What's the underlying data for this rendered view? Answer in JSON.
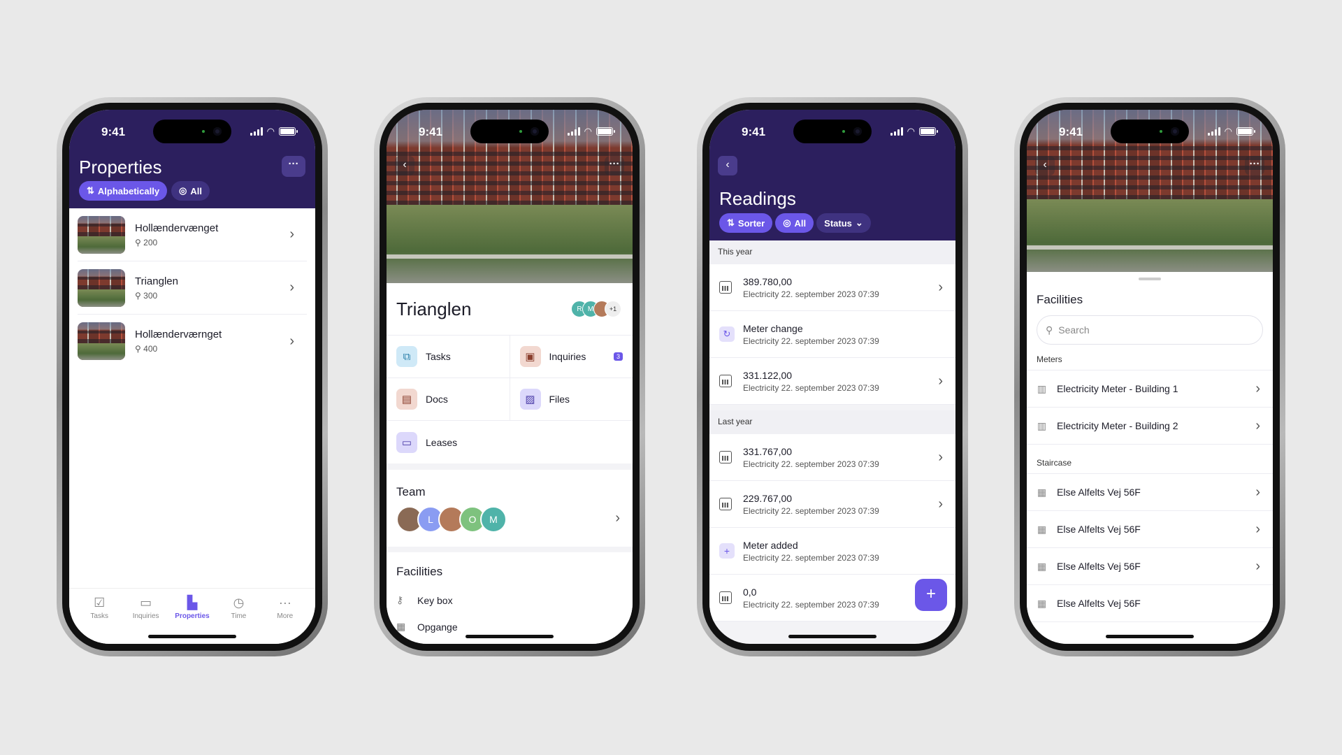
{
  "status_time": "9:41",
  "phone1": {
    "title": "Properties",
    "more_label": "···",
    "filters": [
      {
        "label": "Alphabetically",
        "icon": "sort-icon"
      },
      {
        "label": "All",
        "icon": "person-circle-icon"
      }
    ],
    "properties": [
      {
        "name": "Hollændervænget",
        "count": "200"
      },
      {
        "name": "Trianglen",
        "count": "300"
      },
      {
        "name": "Hollænderværnget",
        "count": "400"
      }
    ],
    "tabs": [
      {
        "label": "Tasks",
        "icon": "tasks-icon"
      },
      {
        "label": "Inquiries",
        "icon": "inbox-icon"
      },
      {
        "label": "Properties",
        "icon": "building-icon"
      },
      {
        "label": "Time",
        "icon": "stopwatch-icon"
      },
      {
        "label": "More",
        "icon": "more-icon"
      }
    ]
  },
  "phone2": {
    "title": "Trianglen",
    "avatars_extra": "+1",
    "avatar_letters": [
      "R",
      "M"
    ],
    "grid": [
      {
        "label": "Tasks",
        "icon": "tasks-icon",
        "color": "#cfe9f7"
      },
      {
        "label": "Inquiries",
        "icon": "briefcase-icon",
        "color": "#f2d8d0",
        "badge": "3"
      },
      {
        "label": "Docs",
        "icon": "document-icon",
        "color": "#f2d8d0"
      },
      {
        "label": "Files",
        "icon": "image-icon",
        "color": "#dcd8fb"
      },
      {
        "label": "Leases",
        "icon": "laptop-icon",
        "color": "#dcd8fb"
      }
    ],
    "team_title": "Team",
    "team": [
      {
        "letter": "",
        "color": "#8a6a55"
      },
      {
        "letter": "L",
        "color": "#8a9cf2"
      },
      {
        "letter": "",
        "color": "#b47a5a"
      },
      {
        "letter": "O",
        "color": "#7ec27e"
      },
      {
        "letter": "M",
        "color": "#4fb3a9"
      }
    ],
    "facilities_title": "Facilities",
    "facilities": [
      {
        "label": "Key box",
        "icon": "key-icon"
      },
      {
        "label": "Opgange",
        "icon": "building-icon"
      }
    ]
  },
  "phone3": {
    "title": "Readings",
    "filters": [
      {
        "label": "Sorter",
        "icon": "sort-icon"
      },
      {
        "label": "All",
        "icon": "person-circle-icon"
      },
      {
        "label": "Status",
        "icon": "chevron-down-icon"
      }
    ],
    "sections": [
      {
        "title": "This year",
        "rows": [
          {
            "title": "389.780,00",
            "sub": "Electricity 22. september 2023 07:39",
            "icon": "chart-icon",
            "chevron": true
          },
          {
            "title": "Meter change",
            "sub": "Electricity 22. september 2023 07:39",
            "icon": "refresh-icon",
            "chevron": false
          },
          {
            "title": "331.122,00",
            "sub": "Electricity 22. september 2023 07:39",
            "icon": "chart-icon",
            "chevron": true
          }
        ]
      },
      {
        "title": "Last year",
        "rows": [
          {
            "title": "331.767,00",
            "sub": "Electricity 22. september 2023 07:39",
            "icon": "chart-icon",
            "chevron": true
          },
          {
            "title": "229.767,00",
            "sub": "Electricity 22. september 2023 07:39",
            "icon": "chart-icon",
            "chevron": true
          },
          {
            "title": "Meter added",
            "sub": "Electricity 22. september 2023 07:39",
            "icon": "plus-icon",
            "chevron": false
          },
          {
            "title": "0,0",
            "sub": "Electricity 22. september 2023 07:39",
            "icon": "chart-icon",
            "chevron": false
          }
        ]
      }
    ],
    "fab_label": "+"
  },
  "phone4": {
    "title": "Facilities",
    "search_placeholder": "Search",
    "meters_title": "Meters",
    "meters": [
      "Electricity Meter - Building 1",
      "Electricity Meter - Building 2"
    ],
    "staircase_title": "Staircase",
    "staircases": [
      "Else Alfelts Vej 56F",
      "Else Alfelts Vej 56F",
      "Else Alfelts Vej 56F",
      "Else Alfelts Vej 56F"
    ]
  },
  "colors": {
    "header": "#2c1f5e",
    "accent": "#6b57e8",
    "background": "#e9e9e9"
  }
}
